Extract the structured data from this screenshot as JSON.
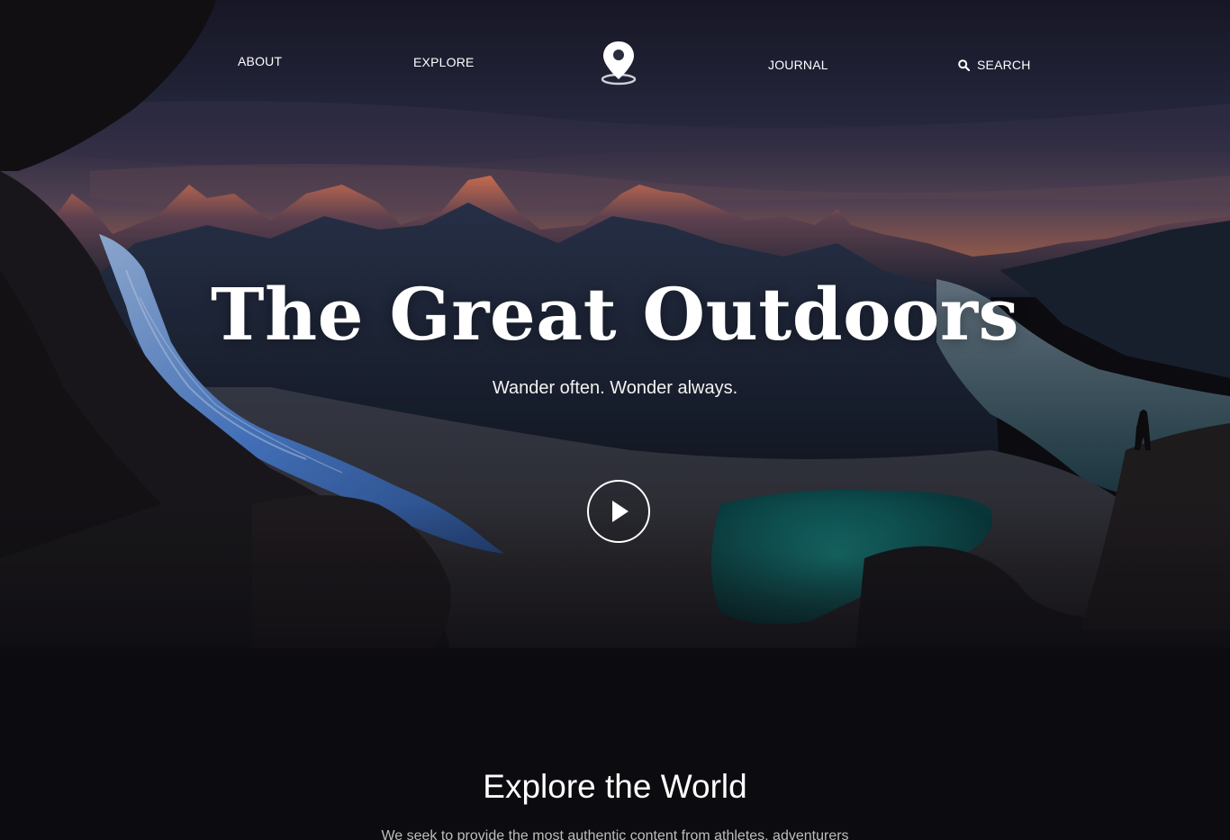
{
  "nav": {
    "about_label": "ABOUT",
    "explore_label": "EXPLORE",
    "journal_label": "JOURNAL",
    "search_label": "SEARCH"
  },
  "hero": {
    "title": "The Great Outdoors",
    "subtitle": "Wander often. Wonder always."
  },
  "intro": {
    "title": "Explore the World",
    "text": "We seek to provide the most authentic content from athletes, adventurers"
  },
  "icons": {
    "logo": "map-pin-icon",
    "search": "search-icon",
    "play": "play-icon"
  },
  "colors": {
    "sky": "#1c1e33",
    "alpenglow": "#d9775a",
    "glacier": "#5d8fd6",
    "lake": "#0f6b6b",
    "page_bg": "#0e0d12"
  }
}
